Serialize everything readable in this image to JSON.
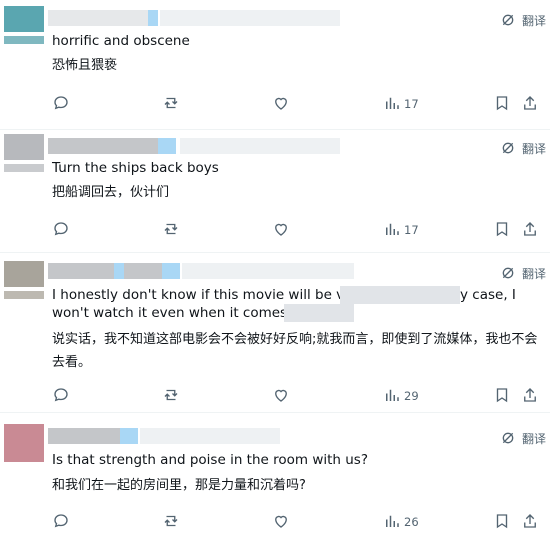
{
  "posts": [
    {
      "text_en": "horrific and obscene",
      "text_zh": "恐怖且猥亵",
      "views": "17",
      "avatar_color": "#5aa6b0",
      "translate_label": "翻译"
    },
    {
      "text_en": "Turn the ships back boys",
      "text_zh": "把船调回去，伙计们",
      "views": "17",
      "avatar_color": "#b7b9bd",
      "translate_label": "翻译"
    },
    {
      "text_en_line1": "I honestly don't know if this movie will be very",
      "text_en_line1_tail": "y case, I",
      "text_en_line2": "won't watch it even when it comes to",
      "text_zh": "说实话，我不知道这部电影会不会被好好反响;就我而言，即使到了流媒体，我也不会去看。",
      "views": "29",
      "avatar_color": "#a8a49b",
      "translate_label": "翻译"
    },
    {
      "text_en": "Is that strength and poise in the room with us?",
      "text_zh": "和我们在一起的房间里，那是力量和沉着吗?",
      "views": "26",
      "avatar_color": "#c98a94",
      "translate_label": "翻译"
    }
  ],
  "colors": {
    "icon": "#536471",
    "accent_blue": "#1d9bf0",
    "divider": "#eff3f4"
  }
}
